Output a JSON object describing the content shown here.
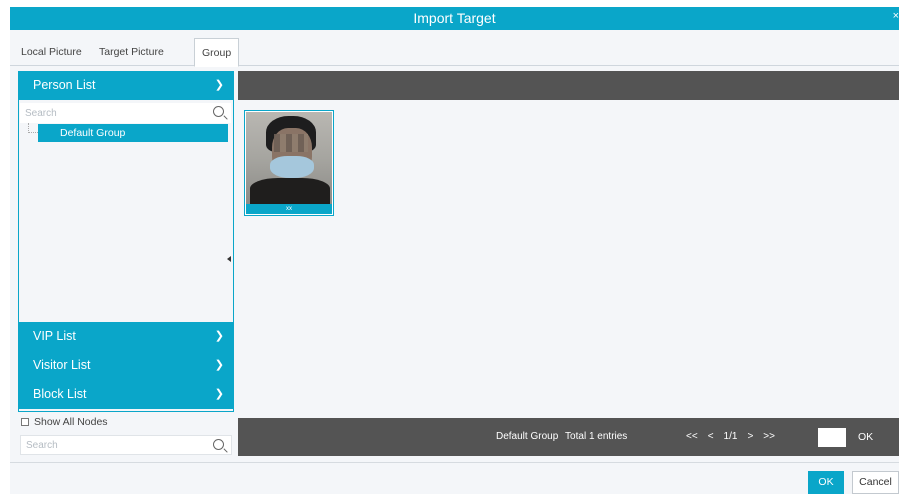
{
  "window": {
    "title": "Import Target",
    "close_glyph": "×"
  },
  "tabs": [
    {
      "label": "Local Picture",
      "active": false
    },
    {
      "label": "Target Picture",
      "active": false
    },
    {
      "label": "Group",
      "active": true
    }
  ],
  "sidebar": {
    "person_list": "Person List",
    "search_placeholder": "Search",
    "tree_items": [
      "Default Group"
    ],
    "vip_list": "VIP List",
    "visitor_list": "Visitor List",
    "block_list": "Block List",
    "show_all_nodes": "Show All Nodes",
    "bottom_search_placeholder": "Search"
  },
  "gallery": {
    "items": [
      {
        "caption": "xx",
        "icon": "person-photo"
      }
    ]
  },
  "statusbar": {
    "group_name": "Default Group",
    "total_text": "Total 1 entries",
    "first": "<<",
    "prev": "<",
    "page": "1/1",
    "next": ">",
    "last": ">>",
    "go_label": "OK"
  },
  "footer": {
    "ok_label": "OK",
    "cancel_label": "Cancel"
  },
  "colors": {
    "accent": "#0aa6c9",
    "dark_bar": "#545454",
    "background": "#f4f6f9"
  }
}
